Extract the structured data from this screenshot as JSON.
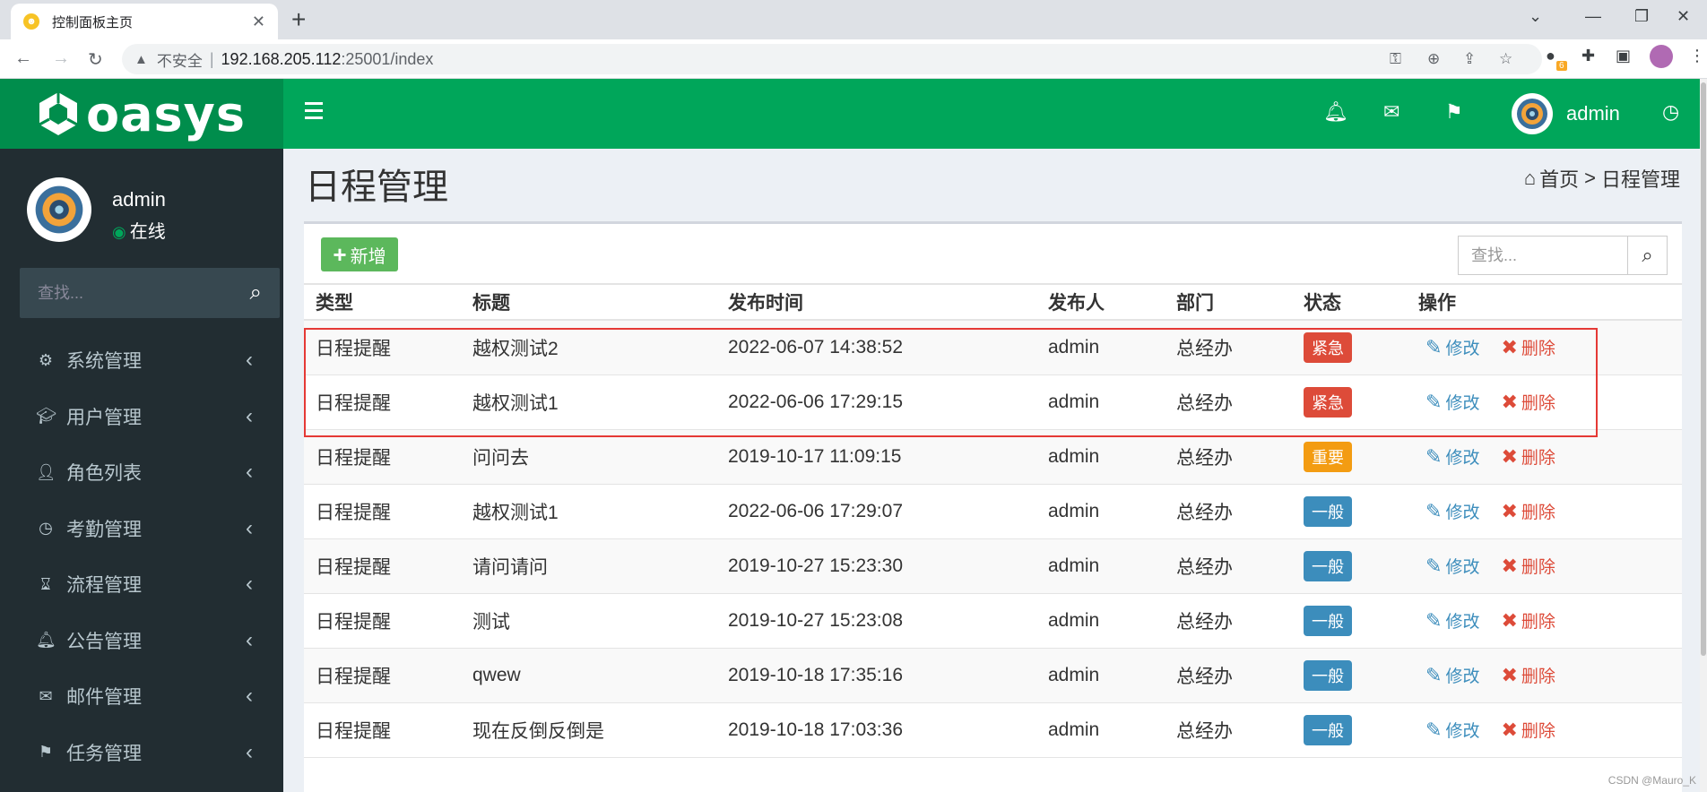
{
  "browser": {
    "tab_title": "控制面板主页",
    "insecure_label": "不安全",
    "url_host": "192.168.205.112",
    "url_path": ":25001/index",
    "ext_badge": "6"
  },
  "app": {
    "logo": "oasys",
    "user": "admin"
  },
  "sidebar": {
    "user_name": "admin",
    "status": "在线",
    "search_placeholder": "查找...",
    "items": [
      {
        "label": "系统管理",
        "icon": "gear-icon"
      },
      {
        "label": "用户管理",
        "icon": "graduation-cap-icon"
      },
      {
        "label": "角色列表",
        "icon": "user-icon"
      },
      {
        "label": "考勤管理",
        "icon": "clock-icon"
      },
      {
        "label": "流程管理",
        "icon": "hourglass-icon"
      },
      {
        "label": "公告管理",
        "icon": "bell-icon"
      },
      {
        "label": "邮件管理",
        "icon": "envelope-icon"
      },
      {
        "label": "任务管理",
        "icon": "flag-icon"
      }
    ]
  },
  "page": {
    "title": "日程管理",
    "breadcrumb_home": "首页",
    "breadcrumb_sep": ">",
    "breadcrumb_current": "日程管理",
    "add_label": "新增",
    "search_placeholder": "查找..."
  },
  "table": {
    "headers": [
      "类型",
      "标题",
      "发布时间",
      "发布人",
      "部门",
      "状态",
      "操作"
    ],
    "edit_label": "修改",
    "delete_label": "删除",
    "rows": [
      {
        "type": "日程提醒",
        "title": "越权测试2",
        "time": "2022-06-07 14:38:52",
        "publisher": "admin",
        "dept": "总经办",
        "status": "紧急",
        "status_color": "#dd4b39"
      },
      {
        "type": "日程提醒",
        "title": "越权测试1",
        "time": "2022-06-06 17:29:15",
        "publisher": "admin",
        "dept": "总经办",
        "status": "紧急",
        "status_color": "#dd4b39"
      },
      {
        "type": "日程提醒",
        "title": "问问去",
        "time": "2019-10-17 11:09:15",
        "publisher": "admin",
        "dept": "总经办",
        "status": "重要",
        "status_color": "#f39c12"
      },
      {
        "type": "日程提醒",
        "title": "越权测试1",
        "time": "2022-06-06 17:29:07",
        "publisher": "admin",
        "dept": "总经办",
        "status": "一般",
        "status_color": "#3c8dbc"
      },
      {
        "type": "日程提醒",
        "title": "请问请问",
        "time": "2019-10-27 15:23:30",
        "publisher": "admin",
        "dept": "总经办",
        "status": "一般",
        "status_color": "#3c8dbc"
      },
      {
        "type": "日程提醒",
        "title": "测试",
        "time": "2019-10-27 15:23:08",
        "publisher": "admin",
        "dept": "总经办",
        "status": "一般",
        "status_color": "#3c8dbc"
      },
      {
        "type": "日程提醒",
        "title": "qwew",
        "time": "2019-10-18 17:35:16",
        "publisher": "admin",
        "dept": "总经办",
        "status": "一般",
        "status_color": "#3c8dbc"
      },
      {
        "type": "日程提醒",
        "title": "现在反倒反倒是",
        "time": "2019-10-18 17:03:36",
        "publisher": "admin",
        "dept": "总经办",
        "status": "一般",
        "status_color": "#3c8dbc"
      }
    ]
  },
  "watermark": "CSDN @Mauro_K",
  "colors": {
    "header_green": "#00a65a",
    "logo_green": "#008d4c",
    "sidebar_bg": "#222d32",
    "highlight_red": "#e53935"
  }
}
